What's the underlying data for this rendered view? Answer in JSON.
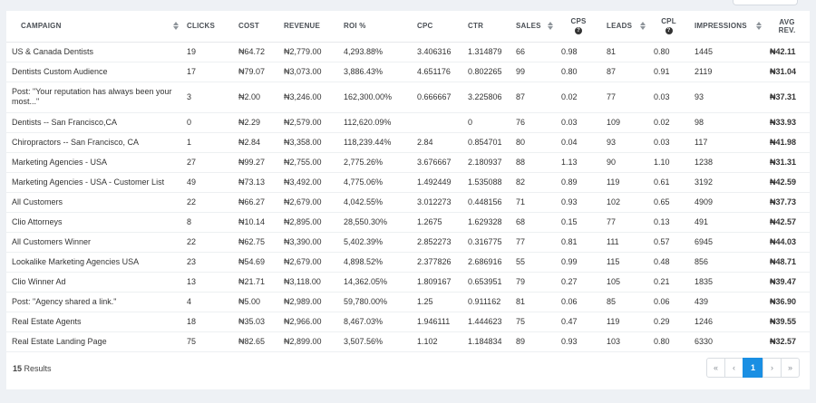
{
  "columns": [
    {
      "key": "campaign",
      "label": "CAMPAIGN"
    },
    {
      "key": "clicks",
      "label": "CLICKS"
    },
    {
      "key": "cost",
      "label": "COST"
    },
    {
      "key": "revenue",
      "label": "REVENUE"
    },
    {
      "key": "roi",
      "label": "ROI %"
    },
    {
      "key": "cpc",
      "label": "CPC"
    },
    {
      "key": "ctr",
      "label": "CTR"
    },
    {
      "key": "sales",
      "label": "SALES"
    },
    {
      "key": "cps",
      "label": "CPS"
    },
    {
      "key": "leads",
      "label": "LEADS"
    },
    {
      "key": "cpl",
      "label": "CPL"
    },
    {
      "key": "impressions",
      "label": "IMPRESSIONS"
    },
    {
      "key": "avg_rev",
      "label": "AVG",
      "label2": "REV."
    }
  ],
  "help_glyph": "?",
  "rows": [
    {
      "campaign": "US & Canada Dentists",
      "clicks": "19",
      "cost": "₦64.72",
      "revenue": "₦2,779.00",
      "roi": "4,293.88%",
      "cpc": "3.406316",
      "ctr": "1.314879",
      "sales": "66",
      "cps": "0.98",
      "leads": "81",
      "cpl": "0.80",
      "impressions": "1445",
      "avg_rev": "₦42.11"
    },
    {
      "campaign": "Dentists Custom Audience",
      "clicks": "17",
      "cost": "₦79.07",
      "revenue": "₦3,073.00",
      "roi": "3,886.43%",
      "cpc": "4.651176",
      "ctr": "0.802265",
      "sales": "99",
      "cps": "0.80",
      "leads": "87",
      "cpl": "0.91",
      "impressions": "2119",
      "avg_rev": "₦31.04"
    },
    {
      "campaign": "Post: \"Your reputation has always been your most...\"",
      "clicks": "3",
      "cost": "₦2.00",
      "revenue": "₦3,246.00",
      "roi": "162,300.00%",
      "cpc": "0.666667",
      "ctr": "3.225806",
      "sales": "87",
      "cps": "0.02",
      "leads": "77",
      "cpl": "0.03",
      "impressions": "93",
      "avg_rev": "₦37.31"
    },
    {
      "campaign": "Dentists -- San Francisco,CA",
      "clicks": "0",
      "cost": "₦2.29",
      "revenue": "₦2,579.00",
      "roi": "112,620.09%",
      "cpc": "",
      "ctr": "0",
      "sales": "76",
      "cps": "0.03",
      "leads": "109",
      "cpl": "0.02",
      "impressions": "98",
      "avg_rev": "₦33.93"
    },
    {
      "campaign": "Chiropractors -- San Francisco, CA",
      "clicks": "1",
      "cost": "₦2.84",
      "revenue": "₦3,358.00",
      "roi": "118,239.44%",
      "cpc": "2.84",
      "ctr": "0.854701",
      "sales": "80",
      "cps": "0.04",
      "leads": "93",
      "cpl": "0.03",
      "impressions": "117",
      "avg_rev": "₦41.98"
    },
    {
      "campaign": "Marketing Agencies - USA",
      "clicks": "27",
      "cost": "₦99.27",
      "revenue": "₦2,755.00",
      "roi": "2,775.26%",
      "cpc": "3.676667",
      "ctr": "2.180937",
      "sales": "88",
      "cps": "1.13",
      "leads": "90",
      "cpl": "1.10",
      "impressions": "1238",
      "avg_rev": "₦31.31"
    },
    {
      "campaign": "Marketing Agencies - USA - Customer List",
      "clicks": "49",
      "cost": "₦73.13",
      "revenue": "₦3,492.00",
      "roi": "4,775.06%",
      "cpc": "1.492449",
      "ctr": "1.535088",
      "sales": "82",
      "cps": "0.89",
      "leads": "119",
      "cpl": "0.61",
      "impressions": "3192",
      "avg_rev": "₦42.59"
    },
    {
      "campaign": "All Customers",
      "clicks": "22",
      "cost": "₦66.27",
      "revenue": "₦2,679.00",
      "roi": "4,042.55%",
      "cpc": "3.012273",
      "ctr": "0.448156",
      "sales": "71",
      "cps": "0.93",
      "leads": "102",
      "cpl": "0.65",
      "impressions": "4909",
      "avg_rev": "₦37.73"
    },
    {
      "campaign": "Clio Attorneys",
      "clicks": "8",
      "cost": "₦10.14",
      "revenue": "₦2,895.00",
      "roi": "28,550.30%",
      "cpc": "1.2675",
      "ctr": "1.629328",
      "sales": "68",
      "cps": "0.15",
      "leads": "77",
      "cpl": "0.13",
      "impressions": "491",
      "avg_rev": "₦42.57"
    },
    {
      "campaign": "All Customers Winner",
      "clicks": "22",
      "cost": "₦62.75",
      "revenue": "₦3,390.00",
      "roi": "5,402.39%",
      "cpc": "2.852273",
      "ctr": "0.316775",
      "sales": "77",
      "cps": "0.81",
      "leads": "111",
      "cpl": "0.57",
      "impressions": "6945",
      "avg_rev": "₦44.03"
    },
    {
      "campaign": "Lookalike Marketing Agencies USA",
      "clicks": "23",
      "cost": "₦54.69",
      "revenue": "₦2,679.00",
      "roi": "4,898.52%",
      "cpc": "2.377826",
      "ctr": "2.686916",
      "sales": "55",
      "cps": "0.99",
      "leads": "115",
      "cpl": "0.48",
      "impressions": "856",
      "avg_rev": "₦48.71"
    },
    {
      "campaign": "Clio Winner Ad",
      "clicks": "13",
      "cost": "₦21.71",
      "revenue": "₦3,118.00",
      "roi": "14,362.05%",
      "cpc": "1.809167",
      "ctr": "0.653951",
      "sales": "79",
      "cps": "0.27",
      "leads": "105",
      "cpl": "0.21",
      "impressions": "1835",
      "avg_rev": "₦39.47"
    },
    {
      "campaign": "Post: \"Agency shared a link.\"",
      "clicks": "4",
      "cost": "₦5.00",
      "revenue": "₦2,989.00",
      "roi": "59,780.00%",
      "cpc": "1.25",
      "ctr": "0.911162",
      "sales": "81",
      "cps": "0.06",
      "leads": "85",
      "cpl": "0.06",
      "impressions": "439",
      "avg_rev": "₦36.90"
    },
    {
      "campaign": "Real Estate Agents",
      "clicks": "18",
      "cost": "₦35.03",
      "revenue": "₦2,966.00",
      "roi": "8,467.03%",
      "cpc": "1.946111",
      "ctr": "1.444623",
      "sales": "75",
      "cps": "0.47",
      "leads": "119",
      "cpl": "0.29",
      "impressions": "1246",
      "avg_rev": "₦39.55"
    },
    {
      "campaign": "Real Estate Landing Page",
      "clicks": "75",
      "cost": "₦82.65",
      "revenue": "₦2,899.00",
      "roi": "3,507.56%",
      "cpc": "1.102",
      "ctr": "1.184834",
      "sales": "89",
      "cps": "0.93",
      "leads": "103",
      "cpl": "0.80",
      "impressions": "6330",
      "avg_rev": "₦32.57"
    }
  ],
  "footer": {
    "count": "15",
    "results_label": "Results"
  },
  "pagination": {
    "first": "«",
    "prev": "‹",
    "current": "1",
    "next": "›",
    "last": "»"
  }
}
